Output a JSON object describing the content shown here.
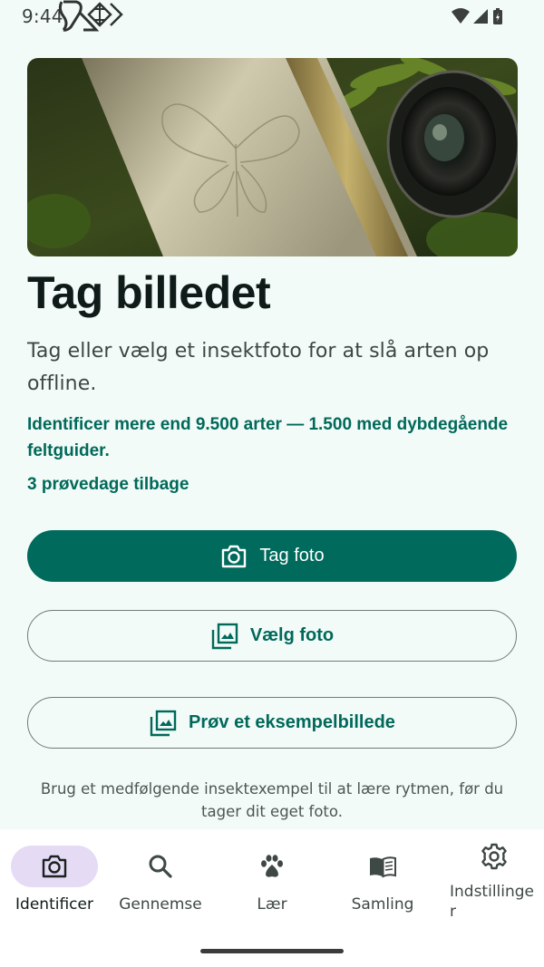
{
  "status_bar": {
    "time": "9:44"
  },
  "main": {
    "title": "Tag billedet",
    "subtitle": "Tag eller vælg et insektfoto for at slå arten op offline.",
    "feature_text": "Identificer mere end 9.500 arter — 1.500 med dybdegående feltguider.",
    "trial_text": "3 prøvedage tilbage",
    "take_photo_label": "Tag foto",
    "choose_photo_label": "Vælg foto",
    "sample_label": "Prøv et eksempelbillede",
    "hint_text": "Brug et medfølgende insektexempel til at lære rytmen, før du tager dit eget foto."
  },
  "nav": {
    "items": [
      {
        "label": "Identificer",
        "icon": "camera-icon",
        "active": true
      },
      {
        "label": "Gennemse",
        "icon": "search-icon",
        "active": false
      },
      {
        "label": "Lær",
        "icon": "paw-icon",
        "active": false
      },
      {
        "label": "Samling",
        "icon": "book-icon",
        "active": false
      },
      {
        "label": "Indstillinger",
        "icon": "gear-icon",
        "active": false
      }
    ]
  },
  "colors": {
    "background": "#F3FBF8",
    "primary": "#006A5C",
    "accent_text": "#00695A",
    "nav_active_pill": "#E5DBF5"
  }
}
